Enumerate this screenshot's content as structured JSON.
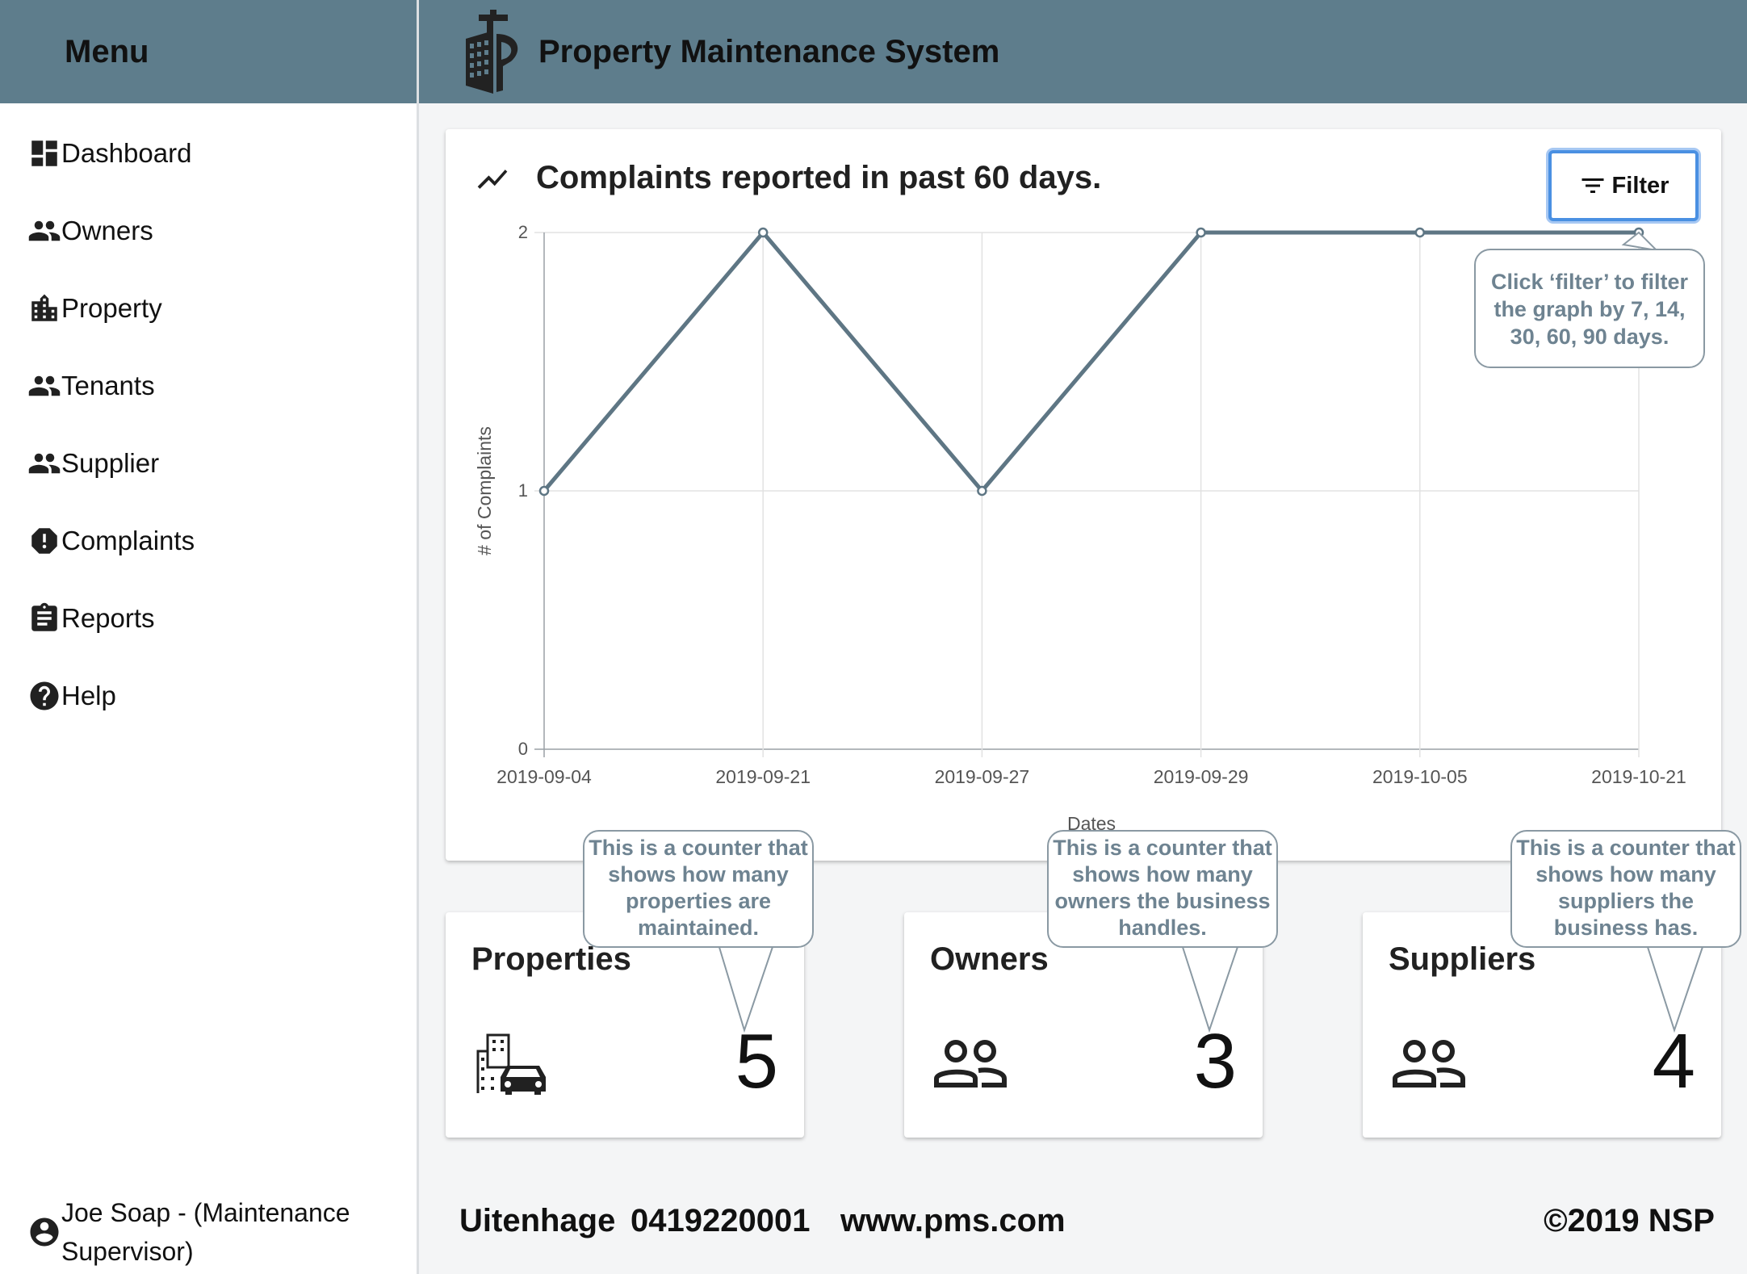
{
  "sidebar": {
    "title": "Menu",
    "items": [
      {
        "label": "Dashboard",
        "icon": "dashboard-icon"
      },
      {
        "label": "Owners",
        "icon": "people-icon"
      },
      {
        "label": "Property",
        "icon": "building-icon"
      },
      {
        "label": "Tenants",
        "icon": "people-icon"
      },
      {
        "label": "Supplier",
        "icon": "people-icon"
      },
      {
        "label": "Complaints",
        "icon": "alert-icon"
      },
      {
        "label": "Reports",
        "icon": "clipboard-icon"
      },
      {
        "label": "Help",
        "icon": "help-icon"
      }
    ],
    "user": "Joe Soap - (Maintenance Supervisor)"
  },
  "header": {
    "title": "Property Maintenance System",
    "logo_icon": "building-tool-logo-icon"
  },
  "chart_card": {
    "title": "Complaints reported in past 60 days.",
    "filter_label": "Filter",
    "filter_callout": "Click ‘filter’ to filter the graph by 7, 14, 30, 60, 90 days."
  },
  "chart_data": {
    "type": "line",
    "x": [
      "2019-09-04",
      "2019-09-21",
      "2019-09-27",
      "2019-09-29",
      "2019-10-05",
      "2019-10-21"
    ],
    "values": [
      1,
      2,
      1,
      2,
      2,
      2
    ],
    "xlabel": "Dates",
    "ylabel": "# of Complaints",
    "ylim": [
      0,
      2
    ],
    "yticks": [
      "0",
      "1",
      "2"
    ],
    "grid": true,
    "line_color": "#5e7684"
  },
  "stats": [
    {
      "title": "Properties",
      "value": "5",
      "icon": "building-car-icon",
      "callout": "This is a counter that shows how many properties are maintained."
    },
    {
      "title": "Owners",
      "value": "3",
      "icon": "people-outline-icon",
      "callout": "This is a counter that shows how many owners the business handles."
    },
    {
      "title": "Suppliers",
      "value": "4",
      "icon": "people-outline-icon",
      "callout": "This is a counter that shows how many suppliers the business has."
    }
  ],
  "footer": {
    "city": "Uitenhage",
    "phone": "0419220001",
    "website": "www.pms.com",
    "copyright": "©2019 NSP"
  }
}
